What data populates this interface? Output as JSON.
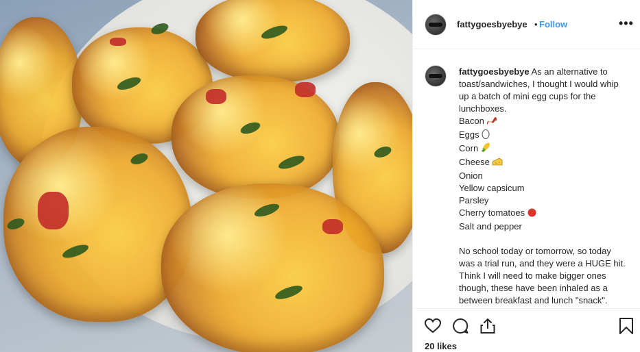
{
  "post": {
    "username": "fattygoesbyebye",
    "separator": "•",
    "follow_label": "Follow",
    "more_label": "•••"
  },
  "caption": {
    "username": "fattygoesbyebye",
    "intro": "As an alternative to toast/sandwiches, I thought I would whip up a batch of mini egg cups for the lunchboxes.",
    "ingredients": [
      {
        "text": "Bacon",
        "icon": "bacon-icon"
      },
      {
        "text": "Eggs",
        "icon": "egg-icon"
      },
      {
        "text": "Corn",
        "icon": "corn-icon"
      },
      {
        "text": "Cheese",
        "icon": "cheese-icon"
      },
      {
        "text": "Onion",
        "icon": ""
      },
      {
        "text": "Yellow capsicum",
        "icon": ""
      },
      {
        "text": "Parsley",
        "icon": ""
      },
      {
        "text": "Cherry tomatoes",
        "icon": "tomato-icon"
      },
      {
        "text": "Salt and pepper",
        "icon": ""
      }
    ],
    "body": "No school today or tomorrow, so today was a trial run, and they were a HUGE hit. Think I will need to make bigger ones though, these have been inhaled as a between breakfast and lunch \"snack\"."
  },
  "actions": {
    "like_icon": "heart-icon",
    "comment_icon": "comment-icon",
    "share_icon": "share-icon",
    "save_icon": "bookmark-icon"
  },
  "likes_text": "20 likes",
  "colors": {
    "follow": "#3897f0",
    "text": "#262626",
    "border": "#efefef"
  }
}
